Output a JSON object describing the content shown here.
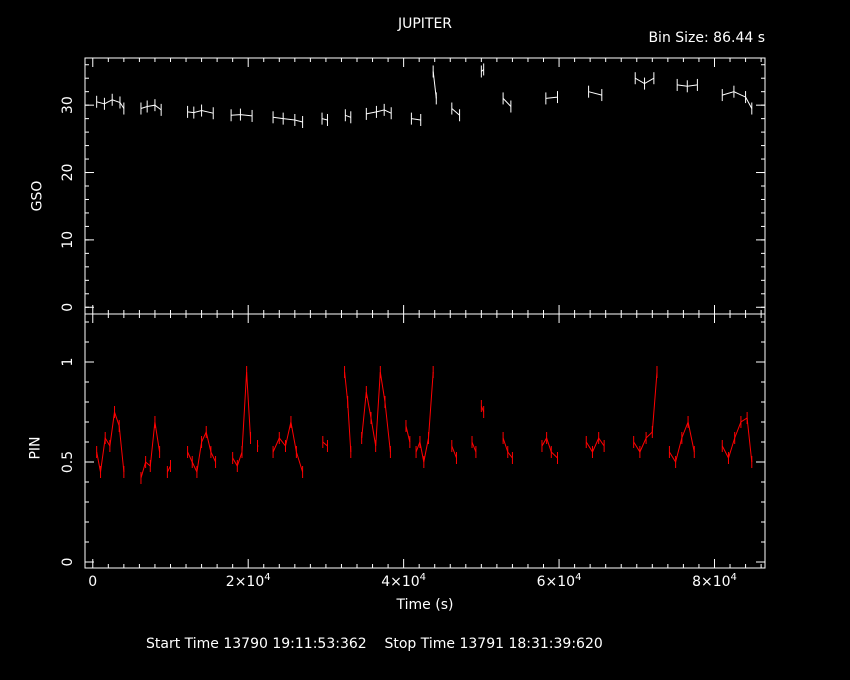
{
  "chart_data": [
    {
      "type": "line",
      "title": "JUPITER",
      "annotation": "Bin Size: 86.44 s",
      "ylabel": "GSO",
      "xlim": [
        -1000,
        86500
      ],
      "ylim": [
        -1,
        37
      ],
      "yticks": [
        "0",
        "10",
        "20",
        "30"
      ],
      "color": "#ffffff",
      "segments": [
        {
          "x": [
            500,
            1500,
            2500,
            3500,
            4000
          ],
          "y": [
            30.5,
            30.2,
            30.8,
            30.4,
            29.5
          ]
        },
        {
          "x": [
            6200,
            7000,
            8000,
            8800
          ],
          "y": [
            29.5,
            29.8,
            30.0,
            29.3
          ]
        },
        {
          "x": [
            12200,
            13000,
            14000,
            15500
          ],
          "y": [
            29.0,
            28.9,
            29.2,
            28.8
          ]
        },
        {
          "x": [
            17800,
            19000,
            20500
          ],
          "y": [
            28.5,
            28.6,
            28.4
          ]
        },
        {
          "x": [
            23200,
            24500,
            26000,
            27000
          ],
          "y": [
            28.2,
            28.0,
            27.8,
            27.5
          ]
        },
        {
          "x": [
            29500,
            30200
          ],
          "y": [
            28.0,
            27.8
          ]
        },
        {
          "x": [
            32500,
            33200
          ],
          "y": [
            28.5,
            28.2
          ]
        },
        {
          "x": [
            35200,
            36500,
            37500,
            38400
          ],
          "y": [
            28.7,
            29.0,
            29.3,
            28.8
          ]
        },
        {
          "x": [
            41000,
            42200
          ],
          "y": [
            28.0,
            27.8
          ]
        },
        {
          "x": [
            43800,
            44200
          ],
          "y": [
            35.0,
            31.0
          ]
        },
        {
          "x": [
            46200,
            47200
          ],
          "y": [
            29.5,
            28.5
          ]
        },
        {
          "x": [
            50000,
            50300
          ],
          "y": [
            35.0,
            35.3
          ]
        },
        {
          "x": [
            52800,
            53800
          ],
          "y": [
            31.0,
            29.8
          ]
        },
        {
          "x": [
            58300,
            59800
          ],
          "y": [
            31.0,
            31.2
          ]
        },
        {
          "x": [
            63800,
            65500
          ],
          "y": [
            32.0,
            31.5
          ]
        },
        {
          "x": [
            69800,
            71000,
            72200
          ],
          "y": [
            34.0,
            33.2,
            34.0
          ]
        },
        {
          "x": [
            75200,
            76500,
            77800
          ],
          "y": [
            33.0,
            32.8,
            33.0
          ]
        },
        {
          "x": [
            81000,
            82500,
            84000,
            84800
          ],
          "y": [
            31.5,
            32.0,
            31.2,
            29.5
          ]
        }
      ]
    },
    {
      "type": "line",
      "ylabel": "PIN",
      "xlabel": "Time (s)",
      "xlim": [
        -1000,
        86500
      ],
      "ylim": [
        -0.03,
        1.24
      ],
      "yticks": [
        "0",
        "0.5",
        "1"
      ],
      "xticks": [
        "0",
        "2×10^4",
        "4×10^4",
        "6×10^4",
        "8×10^4"
      ],
      "color": "#ff0000",
      "segments": [
        {
          "x": [
            500,
            1000,
            1600,
            2200,
            2800,
            3400,
            4000
          ],
          "y": [
            0.55,
            0.45,
            0.62,
            0.58,
            0.75,
            0.68,
            0.45
          ]
        },
        {
          "x": [
            6200,
            6800,
            7400,
            8000,
            8600
          ],
          "y": [
            0.42,
            0.5,
            0.48,
            0.7,
            0.55
          ]
        },
        {
          "x": [
            9600,
            10000
          ],
          "y": [
            0.45,
            0.48
          ]
        },
        {
          "x": [
            12200,
            12800,
            13400,
            14000,
            14600,
            15200,
            15800
          ],
          "y": [
            0.55,
            0.5,
            0.45,
            0.6,
            0.65,
            0.55,
            0.5
          ]
        },
        {
          "x": [
            18000,
            18600,
            19200,
            19800,
            20300
          ],
          "y": [
            0.52,
            0.48,
            0.55,
            0.95,
            0.62
          ]
        },
        {
          "x": [
            21200
          ],
          "y": [
            0.58
          ]
        },
        {
          "x": [
            23200,
            24000,
            24800,
            25500,
            26200,
            27000
          ],
          "y": [
            0.55,
            0.62,
            0.58,
            0.7,
            0.55,
            0.45
          ]
        },
        {
          "x": [
            29600,
            30200
          ],
          "y": [
            0.6,
            0.58
          ]
        },
        {
          "x": [
            32400,
            32800,
            33200
          ],
          "y": [
            0.95,
            0.8,
            0.55
          ]
        },
        {
          "x": [
            34600,
            35200,
            35800,
            36400,
            37000,
            37600,
            38300
          ],
          "y": [
            0.62,
            0.85,
            0.72,
            0.58,
            0.95,
            0.8,
            0.55
          ]
        },
        {
          "x": [
            40300,
            40800
          ],
          "y": [
            0.68,
            0.6
          ]
        },
        {
          "x": [
            41600,
            42100,
            42600,
            43200,
            43800
          ],
          "y": [
            0.55,
            0.6,
            0.5,
            0.62,
            0.95
          ]
        },
        {
          "x": [
            46200,
            46800
          ],
          "y": [
            0.58,
            0.52
          ]
        },
        {
          "x": [
            48800,
            49300
          ],
          "y": [
            0.6,
            0.55
          ]
        },
        {
          "x": [
            50000,
            50300
          ],
          "y": [
            0.78,
            0.75
          ]
        },
        {
          "x": [
            52800,
            53400,
            54000
          ],
          "y": [
            0.62,
            0.55,
            0.52
          ]
        },
        {
          "x": [
            57800,
            58400,
            59000,
            59800
          ],
          "y": [
            0.58,
            0.62,
            0.55,
            0.52
          ]
        },
        {
          "x": [
            63500,
            64300,
            65100,
            65800
          ],
          "y": [
            0.6,
            0.55,
            0.62,
            0.58
          ]
        },
        {
          "x": [
            69600,
            70400,
            71200,
            72000,
            72600
          ],
          "y": [
            0.6,
            0.55,
            0.62,
            0.65,
            0.95
          ]
        },
        {
          "x": [
            74200,
            75000,
            75800,
            76600,
            77400
          ],
          "y": [
            0.55,
            0.5,
            0.62,
            0.7,
            0.55
          ]
        },
        {
          "x": [
            81000,
            81800,
            82600,
            83400,
            84200,
            84800
          ],
          "y": [
            0.58,
            0.52,
            0.62,
            0.7,
            0.72,
            0.5
          ]
        }
      ]
    }
  ],
  "footer": {
    "start": "Start Time 13790 19:11:53:362",
    "stop": "Stop Time 13791 18:31:39:620"
  }
}
